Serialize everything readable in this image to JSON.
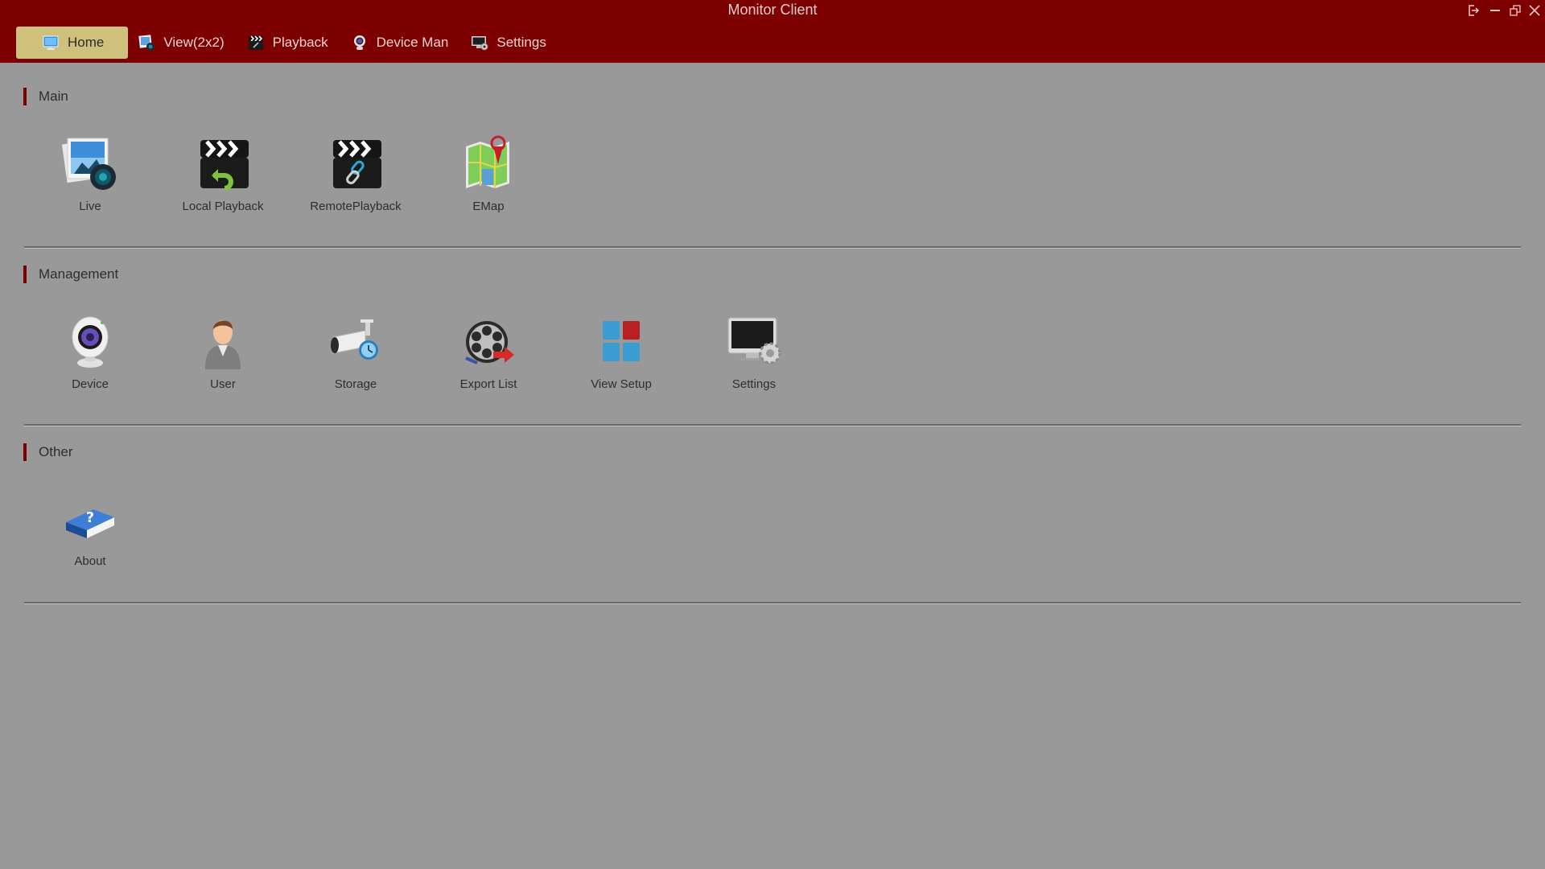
{
  "window": {
    "title": "Monitor Client",
    "controls": [
      {
        "name": "logout",
        "icon": "logout-icon"
      },
      {
        "name": "minimize",
        "icon": "minimize-icon"
      },
      {
        "name": "restore",
        "icon": "restore-icon"
      },
      {
        "name": "close",
        "icon": "close-icon"
      }
    ]
  },
  "colors": {
    "brand": "#7d0000",
    "active_tab": "#cdc17c",
    "background": "#999999"
  },
  "nav": {
    "items": [
      {
        "label": "Home",
        "icon": "monitor-icon",
        "active": true
      },
      {
        "label": "View(2x2)",
        "icon": "photo-camera-icon",
        "active": false
      },
      {
        "label": "Playback",
        "icon": "clapperboard-icon",
        "active": false
      },
      {
        "label": "Device Man",
        "icon": "webcam-icon",
        "active": false
      },
      {
        "label": "Settings",
        "icon": "monitor-gear-icon",
        "active": false
      }
    ]
  },
  "sections": [
    {
      "title": "Main",
      "items": [
        {
          "label": "Live",
          "icon": "live-photo-camera-icon"
        },
        {
          "label": "Local Playback",
          "icon": "clapperboard-undo-icon"
        },
        {
          "label": "RemotePlayback",
          "icon": "clapperboard-link-icon"
        },
        {
          "label": "EMap",
          "icon": "map-pin-icon"
        }
      ]
    },
    {
      "title": "Management",
      "items": [
        {
          "label": "Device",
          "icon": "webcam-icon"
        },
        {
          "label": "User",
          "icon": "user-icon"
        },
        {
          "label": "Storage",
          "icon": "bullet-camera-clock-icon"
        },
        {
          "label": "Export List",
          "icon": "film-reel-export-icon"
        },
        {
          "label": "View Setup",
          "icon": "grid-layout-icon"
        },
        {
          "label": "Settings",
          "icon": "monitor-gear-icon"
        }
      ]
    },
    {
      "title": "Other",
      "items": [
        {
          "label": "About",
          "icon": "help-book-icon"
        }
      ]
    }
  ]
}
